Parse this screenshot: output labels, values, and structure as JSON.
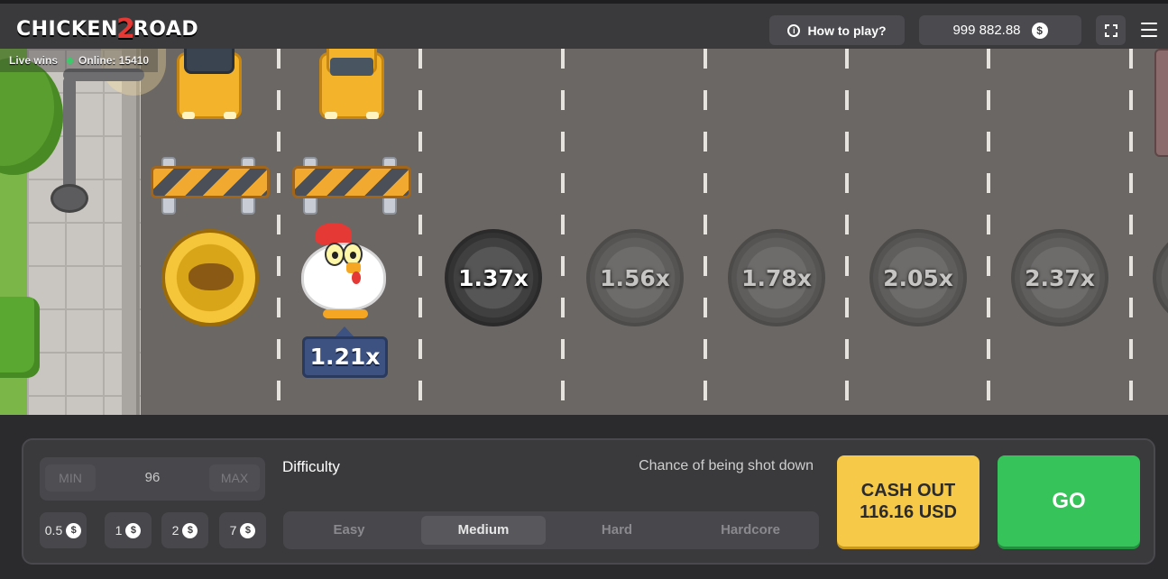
{
  "header": {
    "logo_left": "CHICKEN",
    "logo_num": "2",
    "logo_right": "ROAD",
    "how_to_play": "How to play?",
    "balance": "999 882.88",
    "currency_icon": "$"
  },
  "live": {
    "live_wins": "Live wins",
    "online": "Online: 15410"
  },
  "game": {
    "current_multiplier": "1.21x",
    "lanes": [
      "1.37x",
      "1.56x",
      "1.78x",
      "2.05x",
      "2.37x"
    ]
  },
  "controls": {
    "min_label": "MIN",
    "max_label": "MAX",
    "bet_value": "96",
    "chips": [
      "0.5",
      "1",
      "2",
      "7"
    ],
    "difficulty_label": "Difficulty",
    "chance_label": "Chance of being shot down",
    "difficulties": [
      "Easy",
      "Medium",
      "Hard",
      "Hardcore"
    ],
    "selected_difficulty": "Medium",
    "cashout_line1": "CASH OUT",
    "cashout_line2": "116.16 USD",
    "go_label": "GO"
  },
  "colors": {
    "accent_yellow": "#f7c948",
    "go_green": "#36c359",
    "tag_blue": "#3d5280"
  }
}
